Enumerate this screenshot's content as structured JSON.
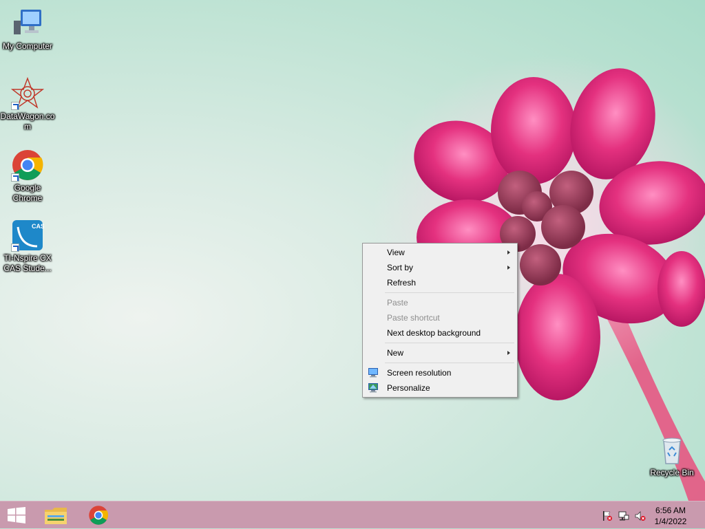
{
  "desktop": {
    "icons": [
      {
        "label": "My Computer",
        "icon": "computer-icon"
      },
      {
        "label": "DataWagon.com",
        "icon": "datawagon-icon"
      },
      {
        "label": "Google Chrome",
        "icon": "chrome-icon"
      },
      {
        "label": "TI-Nspire CX CAS Stude...",
        "icon": "ti-nspire-icon"
      }
    ],
    "recycle_bin": {
      "label": "Recycle Bin",
      "icon": "recycle-bin-icon"
    }
  },
  "context_menu": {
    "items": [
      {
        "label": "View",
        "submenu": true
      },
      {
        "label": "Sort by",
        "submenu": true
      },
      {
        "label": "Refresh"
      },
      {
        "label": "Paste",
        "disabled": true
      },
      {
        "label": "Paste shortcut",
        "disabled": true
      },
      {
        "label": "Next desktop background"
      },
      {
        "label": "New",
        "submenu": true
      },
      {
        "label": "Screen resolution",
        "icon": "screen-resolution-icon"
      },
      {
        "label": "Personalize",
        "icon": "personalize-icon"
      }
    ]
  },
  "taskbar": {
    "start_icon": "windows-logo-icon",
    "pinned": [
      "file-explorer-icon",
      "chrome-icon"
    ],
    "tray_icons": [
      "action-center-flag-icon",
      "network-icon",
      "volume-muted-icon"
    ],
    "clock": {
      "time": "6:56 AM",
      "date": "1/4/2022"
    }
  },
  "colors": {
    "taskbar": "#c99aae",
    "wallpaper": "#bfe3d4",
    "flower": "#e0337f"
  }
}
